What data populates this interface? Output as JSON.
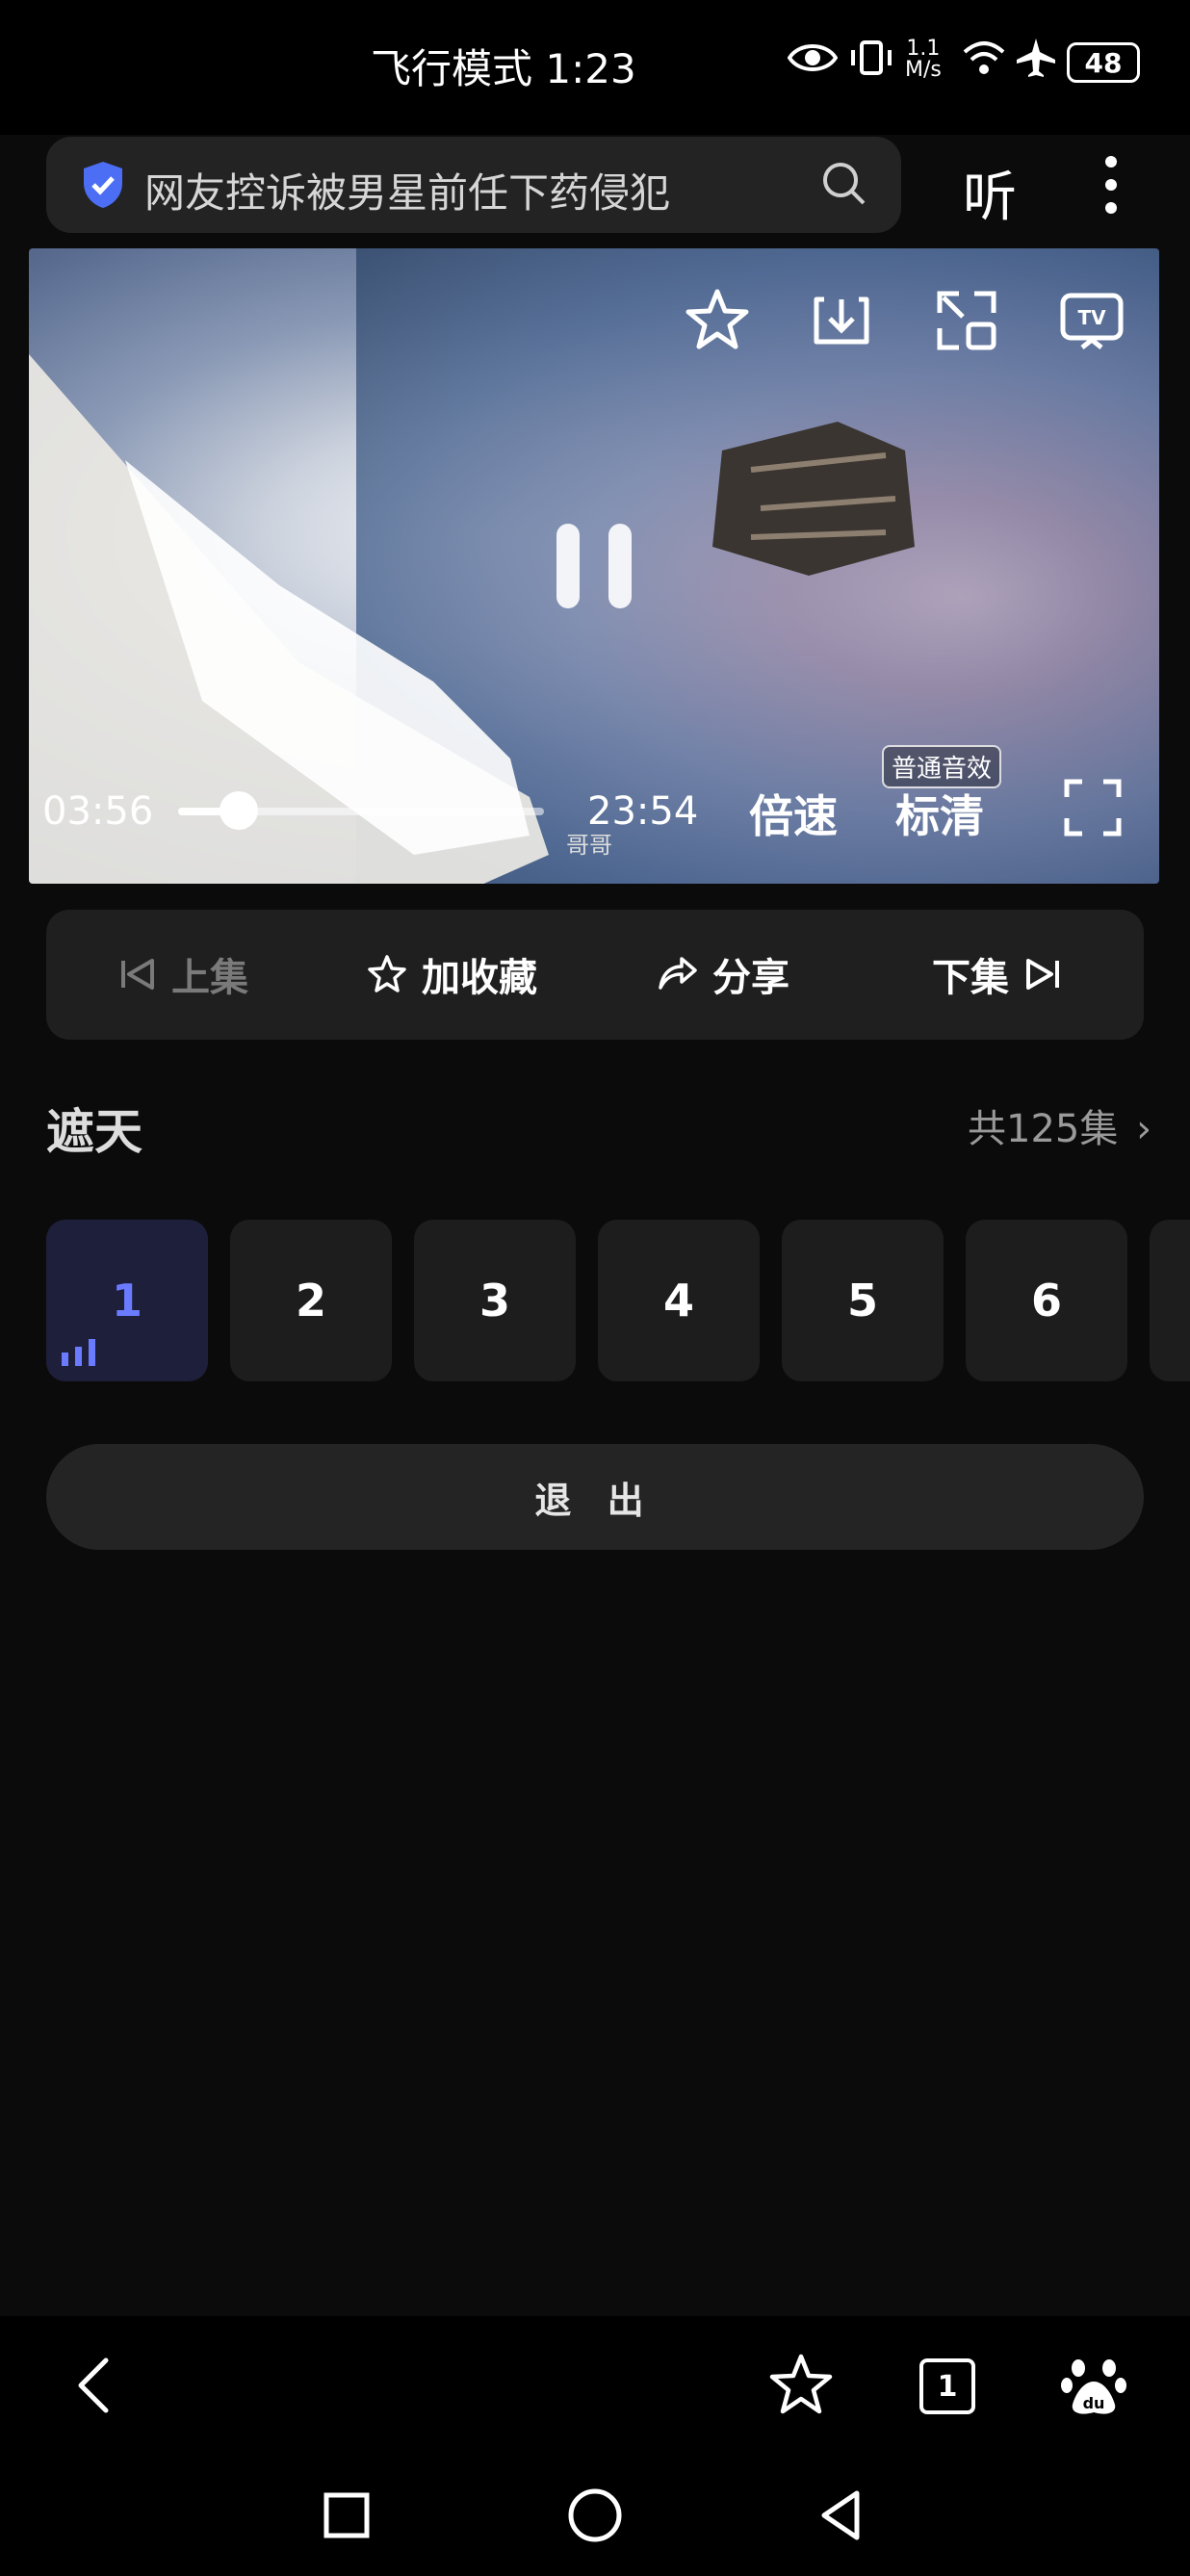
{
  "status_bar": {
    "left_text": "飞行模式 1:23",
    "network_speed_top": "1.1",
    "network_speed_unit": "M/s",
    "battery": "48"
  },
  "search": {
    "query": "网友控诉被男星前任下药侵犯",
    "listen_label": "听"
  },
  "player": {
    "current_time": "03:56",
    "total_time": "23:54",
    "progress": 0.165,
    "speed_label": "倍速",
    "quality_label": "标清",
    "audio_badge": "普通音效",
    "subtitle_text": "哥哥"
  },
  "actions": {
    "prev": "上集",
    "favorite": "加收藏",
    "share": "分享",
    "next": "下集"
  },
  "series": {
    "title": "遮天",
    "episode_count": "共125集",
    "episodes": [
      "1",
      "2",
      "3",
      "4",
      "5",
      "6"
    ]
  },
  "exit_label": "退 出",
  "toolbar": {
    "tabs_count": "1"
  },
  "colors": {
    "accent": "#6b7bff",
    "background": "#0b0b0b",
    "card": "#1d1d1d"
  }
}
